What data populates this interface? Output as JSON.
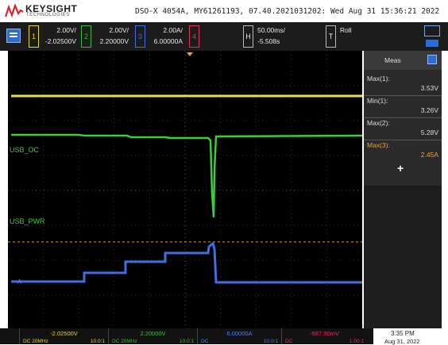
{
  "header": {
    "brand": "KEYSIGHT",
    "brand_sub": "TECHNOLOGIES",
    "device_info": "DSO-X 4054A, MY61261193, 07.40.2021031202: Wed Aug 31 15:36:21 2022"
  },
  "channels": [
    {
      "num": "1",
      "scale": "2.00V/",
      "offset": "-2.02500V",
      "color": "#e8d23a"
    },
    {
      "num": "2",
      "scale": "2.00V/",
      "offset": "2.20000V",
      "color": "#3dba3a"
    },
    {
      "num": "3",
      "scale": "2.00A/",
      "offset": "6.00000A",
      "color": "#3f6fe0"
    },
    {
      "num": "4",
      "scale": "",
      "offset": "",
      "color": "#e0325a"
    }
  ],
  "horizontal": {
    "label": "H",
    "scale": "50.00ms/",
    "position": "-5.508s"
  },
  "trigger": {
    "label": "T",
    "mode": "Roll"
  },
  "trace_labels": {
    "usb_oc": "USB_OC",
    "usb_pwr": "USB_PWR",
    "ch3_marker": "A"
  },
  "measurements": {
    "title": "Meas",
    "items": [
      {
        "label": "Max(1):",
        "value": "3.53V",
        "color": "#dddddd"
      },
      {
        "label": "Min(1):",
        "value": "3.26V",
        "color": "#dddddd"
      },
      {
        "label": "Max(2):",
        "value": "5.28V",
        "color": "#dddddd"
      },
      {
        "label": "Max(3):",
        "value": "2.45A",
        "color": "#e8a040"
      }
    ],
    "add_symbol": "+"
  },
  "bottom": [
    {
      "value": "-2.02500V",
      "coupling": "DC 20MHz",
      "probe": "10.0:1",
      "color": "#e8d23a"
    },
    {
      "value": "2.20000V",
      "coupling": "DC 20MHz",
      "probe": "10.0:1",
      "color": "#3dba3a"
    },
    {
      "value": "6.00000A",
      "coupling": "DC",
      "probe": "10.0:1",
      "color": "#4f7ff0"
    },
    {
      "value": "-687.50mV",
      "coupling": "DC",
      "probe": "1.00:1",
      "color": "#e0325a"
    }
  ],
  "clock": {
    "time": "3:35 PM",
    "date": "Aug 31, 2022"
  },
  "colors": {
    "ch1": "#e8d23a",
    "ch2": "#3dba3a",
    "ch3": "#3f6fe0",
    "ch4": "#e0325a",
    "trigger_level": "#e8a040"
  }
}
